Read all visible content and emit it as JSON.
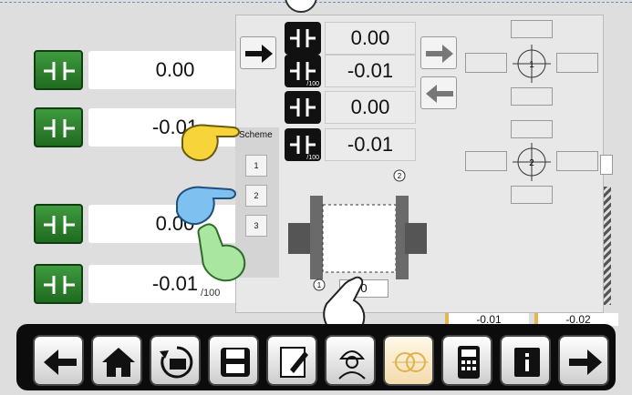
{
  "left_readings": [
    {
      "value": "0.00",
      "unit": ""
    },
    {
      "value": "-0.01",
      "unit": ""
    },
    {
      "value": "0.00",
      "unit": ""
    },
    {
      "value": "-0.01",
      "unit": "/100"
    }
  ],
  "scheme": {
    "label": "Scheme",
    "options": [
      "1",
      "2",
      "3"
    ]
  },
  "center_readings": [
    {
      "value": "0.00",
      "sub": ""
    },
    {
      "value": "-0.01",
      "sub": "/100"
    },
    {
      "value": "0.00",
      "sub": ""
    },
    {
      "value": "-0.01",
      "sub": "/100"
    }
  ],
  "targets": {
    "t1": "1",
    "t2": "2"
  },
  "diagram": {
    "p1": "1",
    "p2": "2",
    "bottom_value": "0"
  },
  "bottom_values": [
    "-0.01",
    "-0.02"
  ],
  "colors": {
    "accent_green": "#2e8b2e",
    "highlight": "#e5b64f",
    "bar": "#0c0c0c"
  },
  "toolbar": {
    "icons": [
      "arrow-left-icon",
      "home-icon",
      "rotate-icon",
      "save-icon",
      "notes-icon",
      "operator-icon",
      "target-icon",
      "calculator-icon",
      "info-icon",
      "arrow-right-icon"
    ]
  }
}
